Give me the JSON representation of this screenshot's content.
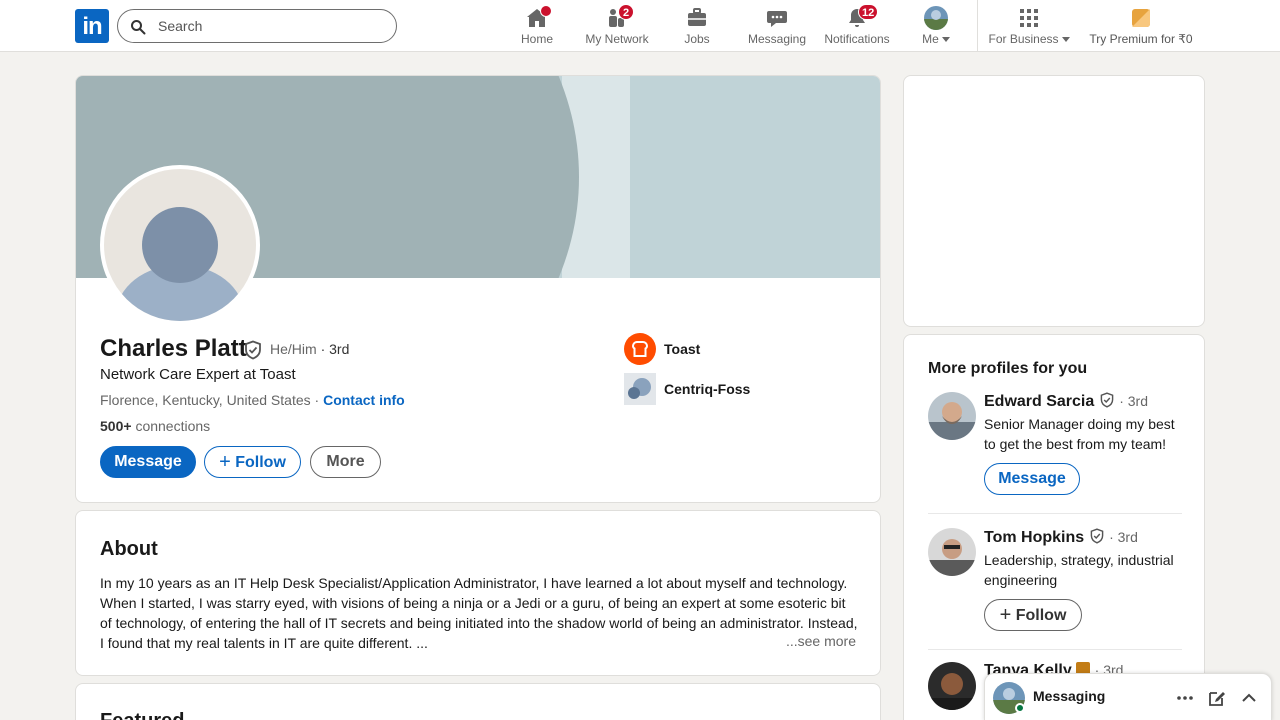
{
  "nav": {
    "search_placeholder": "Search",
    "items": [
      {
        "label": "Home",
        "icon": "home-icon"
      },
      {
        "label": "My Network",
        "icon": "network-icon",
        "badge": "2"
      },
      {
        "label": "Jobs",
        "icon": "jobs-icon"
      },
      {
        "label": "Messaging",
        "icon": "messaging-icon"
      },
      {
        "label": "Notifications",
        "icon": "bell-icon",
        "badge": "12"
      },
      {
        "label": "Me",
        "icon": "avatar"
      },
      {
        "label": "For Business",
        "icon": "grid-icon"
      },
      {
        "label": "Try Premium for ₹0",
        "icon": "premium-icon"
      }
    ]
  },
  "profile": {
    "name": "Charles Platt",
    "pronouns": "He/Him",
    "degree": "· 3rd",
    "headline": "Network Care Expert at Toast",
    "location": "Florence, Kentucky, United States ·",
    "contact_info": "Contact info",
    "connections_count": "500+",
    "connections_label": "connections",
    "buttons": {
      "message": "Message",
      "follow": "Follow",
      "more": "More"
    },
    "companies": [
      {
        "name": "Toast",
        "color": "#ff4c00"
      },
      {
        "name": "Centriq-Foss",
        "color": "#8aa2bd"
      }
    ]
  },
  "about": {
    "title": "About",
    "text": "In my 10 years as an IT Help Desk Specialist/Application Administrator, I have learned a lot about myself and technology. When I started, I was starry eyed, with visions of being a ninja or a Jedi or a guru, of being an expert at some esoteric bit of technology, of entering the hall of IT secrets and being initiated into the shadow world of being an administrator. Instead, I found that my real talents in IT are quite different. ...",
    "see_more": "...see more"
  },
  "featured": {
    "title": "Featured"
  },
  "more_profiles": {
    "title": "More profiles for you",
    "people": [
      {
        "name": "Edward Sarcia",
        "degree": "· 3rd",
        "desc": "Senior Manager doing my best to get the best from my team!",
        "action": "Message"
      },
      {
        "name": "Tom Hopkins",
        "degree": "· 3rd",
        "desc": "Leadership, strategy, industrial engineering",
        "action": "Follow"
      },
      {
        "name": "Tanya Kelly",
        "degree": "· 3rd",
        "desc": "",
        "action": ""
      }
    ]
  },
  "messaging": {
    "label": "Messaging"
  },
  "colors": {
    "brand": "#0a66c2",
    "badge": "#cb112d",
    "online": "#057642"
  }
}
